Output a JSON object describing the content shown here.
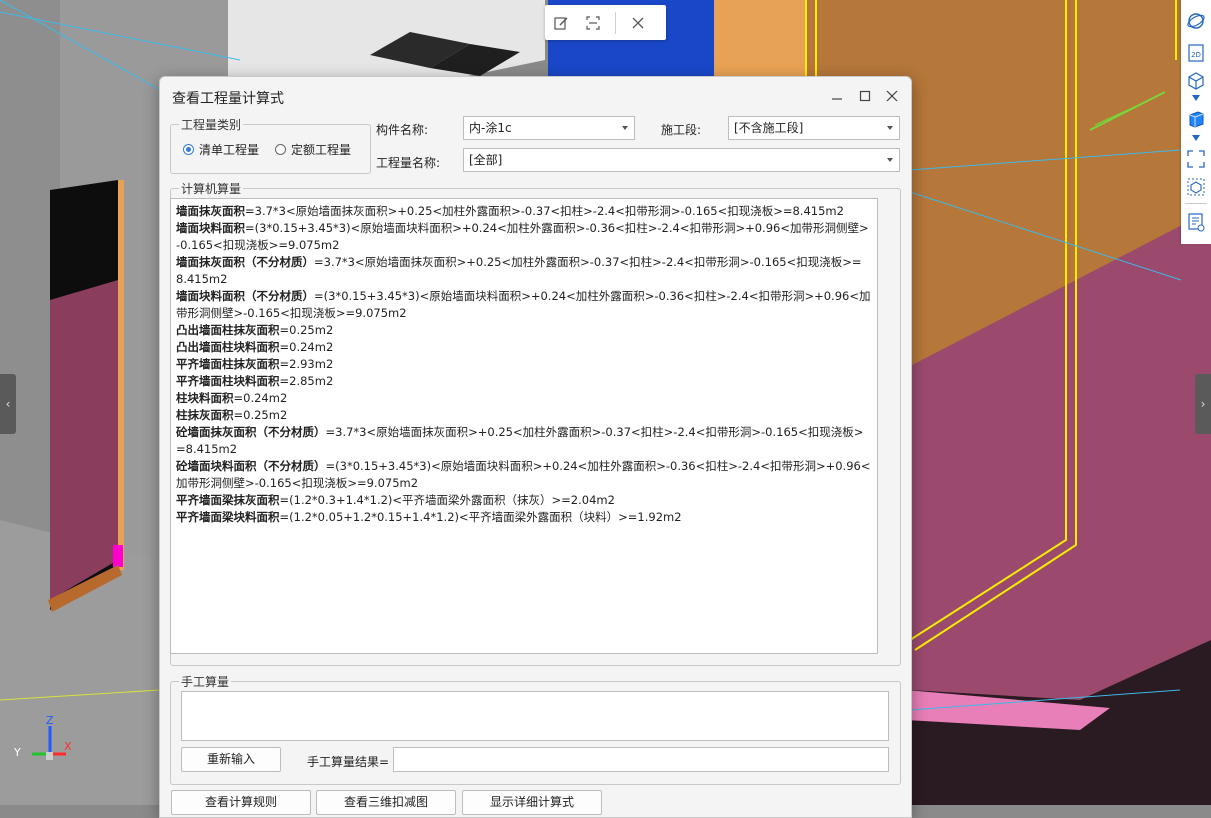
{
  "floating_toolbar": {
    "icons": [
      "edit-icon",
      "scan-icon",
      "close-icon"
    ]
  },
  "right_toolbar": {
    "icons": [
      "orbit-icon",
      "2d-view-icon",
      "3d-view-icon",
      "cube-icon",
      "fullscreen-icon",
      "box-select-icon",
      "report-icon"
    ],
    "view_2d_label": "2D"
  },
  "side_handles": {
    "left": "‹",
    "right": "›"
  },
  "axis": {
    "x": "X",
    "y": "Y",
    "z": "Z"
  },
  "dialog": {
    "title": "查看工程量计算式",
    "quantity_type": {
      "legend": "工程量类别",
      "options": [
        {
          "label": "清单工程量",
          "checked": true
        },
        {
          "label": "定额工程量",
          "checked": false
        }
      ]
    },
    "component_name": {
      "label": "构件名称:",
      "value": "内-涂1c"
    },
    "construction_section": {
      "label": "施工段:",
      "value": "[不含施工段]"
    },
    "quantity_name": {
      "label": "工程量名称:",
      "value": "[全部]"
    },
    "computer_calc": {
      "legend": "计算机算量",
      "lines": [
        {
          "name": "墙面抹灰面积",
          "expr": "=3.7*3<原始墙面抹灰面积>+0.25<加柱外露面积>-0.37<扣柱>-2.4<扣带形洞>-0.165<扣现浇板>=8.415m2"
        },
        {
          "name": "墙面块料面积",
          "expr": "=(3*0.15+3.45*3)<原始墙面块料面积>+0.24<加柱外露面积>-0.36<扣柱>-2.4<扣带形洞>+0.96<加带形洞侧壁>-0.165<扣现浇板>=9.075m2"
        },
        {
          "name": "墙面抹灰面积（不分材质）",
          "expr": "=3.7*3<原始墙面抹灰面积>+0.25<加柱外露面积>-0.37<扣柱>-2.4<扣带形洞>-0.165<扣现浇板>=8.415m2"
        },
        {
          "name": "墙面块料面积（不分材质）",
          "expr": "=(3*0.15+3.45*3)<原始墙面块料面积>+0.24<加柱外露面积>-0.36<扣柱>-2.4<扣带形洞>+0.96<加带形洞侧壁>-0.165<扣现浇板>=9.075m2"
        },
        {
          "name": "凸出墙面柱抹灰面积",
          "expr": "=0.25m2"
        },
        {
          "name": "凸出墙面柱块料面积",
          "expr": "=0.24m2"
        },
        {
          "name": "平齐墙面柱抹灰面积",
          "expr": "=2.93m2"
        },
        {
          "name": "平齐墙面柱块料面积",
          "expr": "=2.85m2"
        },
        {
          "name": "柱块料面积",
          "expr": "=0.24m2"
        },
        {
          "name": "柱抹灰面积",
          "expr": "=0.25m2"
        },
        {
          "name": "砼墙面抹灰面积（不分材质）",
          "expr": "=3.7*3<原始墙面抹灰面积>+0.25<加柱外露面积>-0.37<扣柱>-2.4<扣带形洞>-0.165<扣现浇板>=8.415m2"
        },
        {
          "name": "砼墙面块料面积（不分材质）",
          "expr": "=(3*0.15+3.45*3)<原始墙面块料面积>+0.24<加柱外露面积>-0.36<扣柱>-2.4<扣带形洞>+0.96<加带形洞侧壁>-0.165<扣现浇板>=9.075m2"
        },
        {
          "name": "平齐墙面梁抹灰面积",
          "expr": "=(1.2*0.3+1.4*1.2)<平齐墙面梁外露面积（抹灰）>=2.04m2"
        },
        {
          "name": "平齐墙面梁块料面积",
          "expr": "=(1.2*0.05+1.2*0.15+1.4*1.2)<平齐墙面梁外露面积（块料）>=1.92m2"
        }
      ]
    },
    "manual_calc": {
      "legend": "手工算量",
      "reenter_label": "重新输入",
      "result_label": "手工算量结果=",
      "result_value": ""
    },
    "bottom_buttons": [
      "查看计算规则",
      "查看三维扣减图",
      "显示详细计算式"
    ]
  },
  "colors": {
    "accent": "#3a7bd5",
    "wall_orange": "#b5773a",
    "wall_pink": "#9b4a6e",
    "blue_panel": "#1a47c8"
  }
}
